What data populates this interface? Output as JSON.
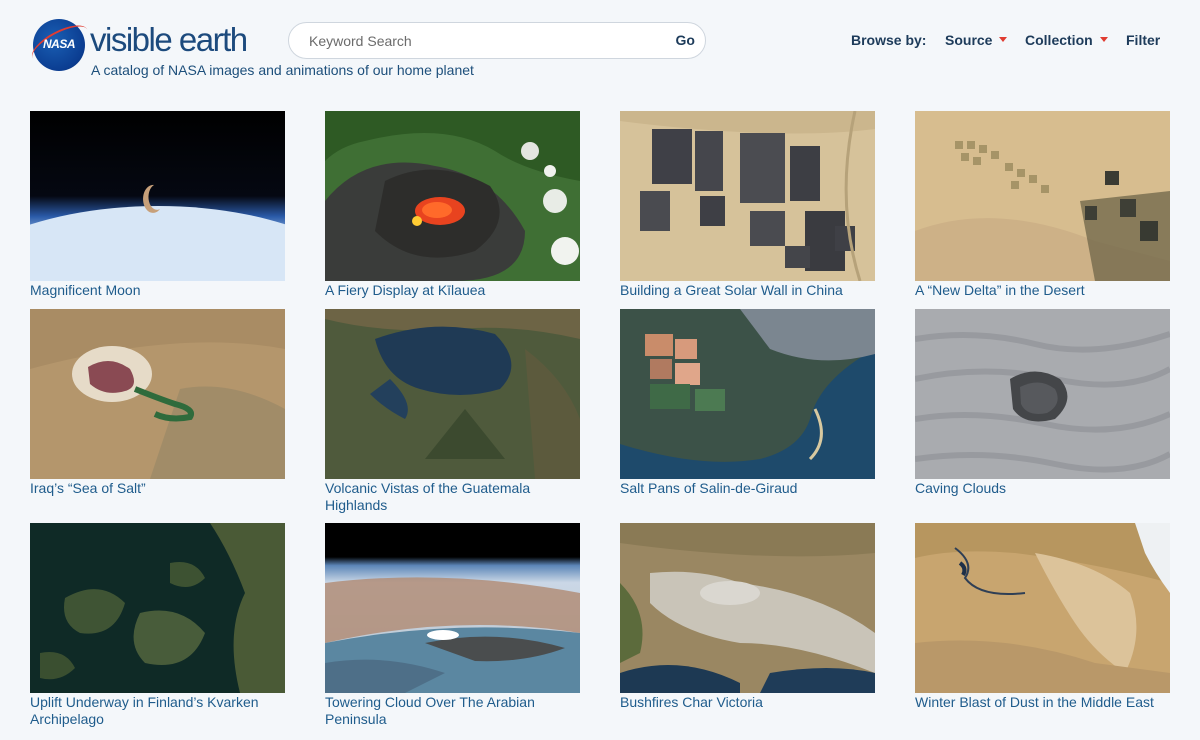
{
  "header": {
    "logo_label": "NASA",
    "site_title": "visible earth",
    "tagline": "A catalog of NASA images and animations of our home planet"
  },
  "search": {
    "placeholder": "Keyword Search",
    "button": "Go"
  },
  "browse": {
    "label": "Browse by:",
    "source": "Source",
    "collection": "Collection",
    "filter": "Filter"
  },
  "accent_color": "#e03c31",
  "link_color": "#1f5c8c",
  "cards": [
    {
      "title": "Magnificent Moon"
    },
    {
      "title": "A Fiery Display at Kīlauea"
    },
    {
      "title": "Building a Great Solar Wall in China"
    },
    {
      "title": "A “New Delta” in the Desert"
    },
    {
      "title": "Iraq’s “Sea of Salt”"
    },
    {
      "title": "Volcanic Vistas of the Guatemala Highlands"
    },
    {
      "title": "Salt Pans of Salin-de-Giraud"
    },
    {
      "title": "Caving Clouds"
    },
    {
      "title": "Uplift Underway in Finland’s Kvarken Archipelago"
    },
    {
      "title": "Towering Cloud Over The Arabian Peninsula"
    },
    {
      "title": "Bushfires Char Victoria"
    },
    {
      "title": "Winter Blast of Dust in the Middle East"
    }
  ]
}
